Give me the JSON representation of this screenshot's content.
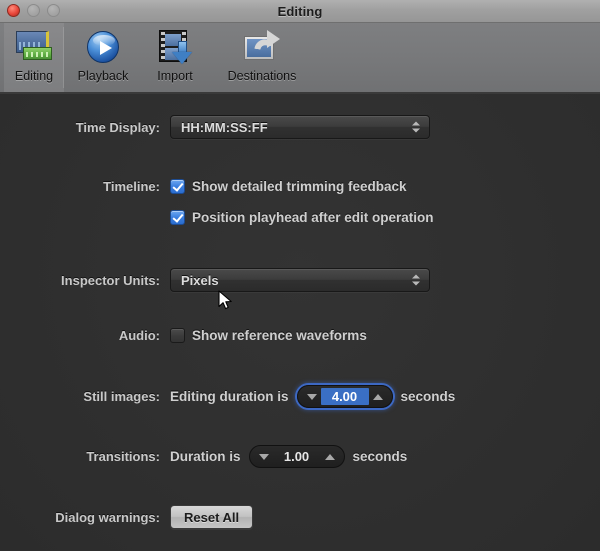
{
  "window": {
    "title": "Editing",
    "traffic_lights": [
      {
        "name": "close",
        "color": "#e8463a",
        "enabled": true
      },
      {
        "name": "minimize",
        "color": "#a4a4a4",
        "enabled": false
      },
      {
        "name": "zoom",
        "color": "#a4a4a4",
        "enabled": false
      }
    ]
  },
  "toolbar": {
    "items": [
      {
        "label": "Editing",
        "icon": "editing-icon",
        "selected": true
      },
      {
        "label": "Playback",
        "icon": "playback-icon",
        "selected": false
      },
      {
        "label": "Import",
        "icon": "import-icon",
        "selected": false
      },
      {
        "label": "Destinations",
        "icon": "destinations-icon",
        "selected": false
      }
    ]
  },
  "settings": {
    "time_display": {
      "label": "Time Display:",
      "value": "HH:MM:SS:FF"
    },
    "timeline": {
      "label": "Timeline:",
      "checkbox_1": {
        "label": "Show detailed trimming feedback",
        "checked": true
      },
      "checkbox_2": {
        "label": "Position playhead after edit operation",
        "checked": true
      }
    },
    "inspector_units": {
      "label": "Inspector Units:",
      "value": "Pixels"
    },
    "audio": {
      "label": "Audio:",
      "checkbox": {
        "label": "Show reference waveforms",
        "checked": false
      }
    },
    "still_images": {
      "label": "Still images:",
      "prefix": "Editing duration is",
      "value": "4.00",
      "suffix": "seconds",
      "focused": true
    },
    "transitions": {
      "label": "Transitions:",
      "prefix": "Duration is",
      "value": "1.00",
      "suffix": "seconds",
      "focused": false
    },
    "dialog_warnings": {
      "label": "Dialog warnings:",
      "button": "Reset All"
    }
  },
  "colors": {
    "window_background": "#2e2e2e",
    "toolbar_background": "#77787a",
    "accent_blue": "#3b7fe0",
    "focus_ring": "#3e6ed2",
    "label_text": "#c8c8c8"
  }
}
